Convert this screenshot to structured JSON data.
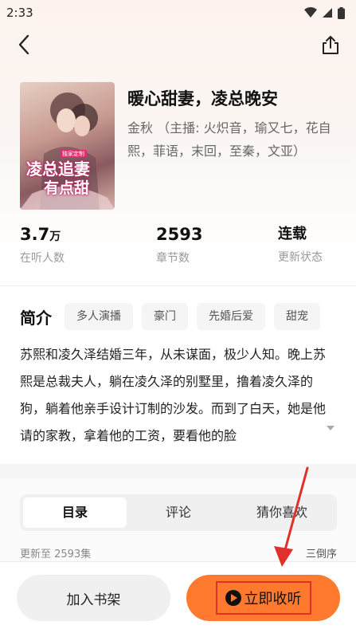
{
  "status_bar": {
    "time": "2:33"
  },
  "book": {
    "title": "暖心甜妻，凌总晚安",
    "meta": "金秋 （主播: 火炽音，瑜又七，花自熙，菲语，末回，至秦，文亚）",
    "cover": {
      "title_line1": "凌总追妻",
      "title_line2": "有点甜",
      "tag": "独家定制"
    }
  },
  "stats": [
    {
      "value": "3.7",
      "unit": "万",
      "label": "在听人数"
    },
    {
      "value": "2593",
      "unit": "",
      "label": "章节数"
    },
    {
      "value": "连载",
      "unit": "",
      "label": "更新状态"
    }
  ],
  "intro": {
    "title": "简介",
    "tags": [
      "多人演播",
      "豪门",
      "先婚后爱",
      "甜宠"
    ],
    "text": "苏熙和凌久泽结婚三年，从未谋面，极少人知。晚上苏熙是总裁夫人，躺在凌久泽的别墅里，撸着凌久泽的狗，躺着他亲手设计订制的沙发。而到了白天，她是他请的家教，拿着他的工资，要看他的脸"
  },
  "tabs": [
    "目录",
    "评论",
    "猜你喜欢"
  ],
  "update": {
    "text": "更新至 2593集",
    "order": "三倒序"
  },
  "buttons": {
    "shelf": "加入书架",
    "listen": "立即收听"
  },
  "colors": {
    "accent": "#ff7a2e",
    "highlight": "#e0302c"
  },
  "icons": [
    "back-arrow-icon",
    "share-icon",
    "play-icon",
    "expand-triangle-icon"
  ]
}
